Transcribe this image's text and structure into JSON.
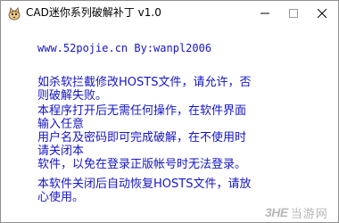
{
  "window": {
    "title": "CAD迷你系列破解补丁 v1.0",
    "icon": "cat-app-icon"
  },
  "controls": {
    "minimize_icon": "minimize-icon",
    "maximize_icon": "maximize-icon",
    "close_icon": "close-icon"
  },
  "content": {
    "site_line": "www.52pojie.cn    By:wanpl2006",
    "paragraph1": [
      "如杀软拦截修改HOSTS文件，请允许，否",
      "则破解失败。"
    ],
    "paragraph2": [
      "本程序打开后无需任何操作，在软件界面",
      "输入任意",
      "用户名及密码即可完成破解，在不使用时",
      "请关闭本",
      "软件，以免在登录正版帐号时无法登录。"
    ],
    "paragraph3": [
      "本软件关闭后自动恢复HOSTS文件，请放",
      "心使用。"
    ]
  },
  "watermark": {
    "logo": "3HE",
    "text": "当游网"
  },
  "colors": {
    "text": "#1515c8",
    "background": "#ffffff",
    "watermark": "#b8b8b8"
  }
}
